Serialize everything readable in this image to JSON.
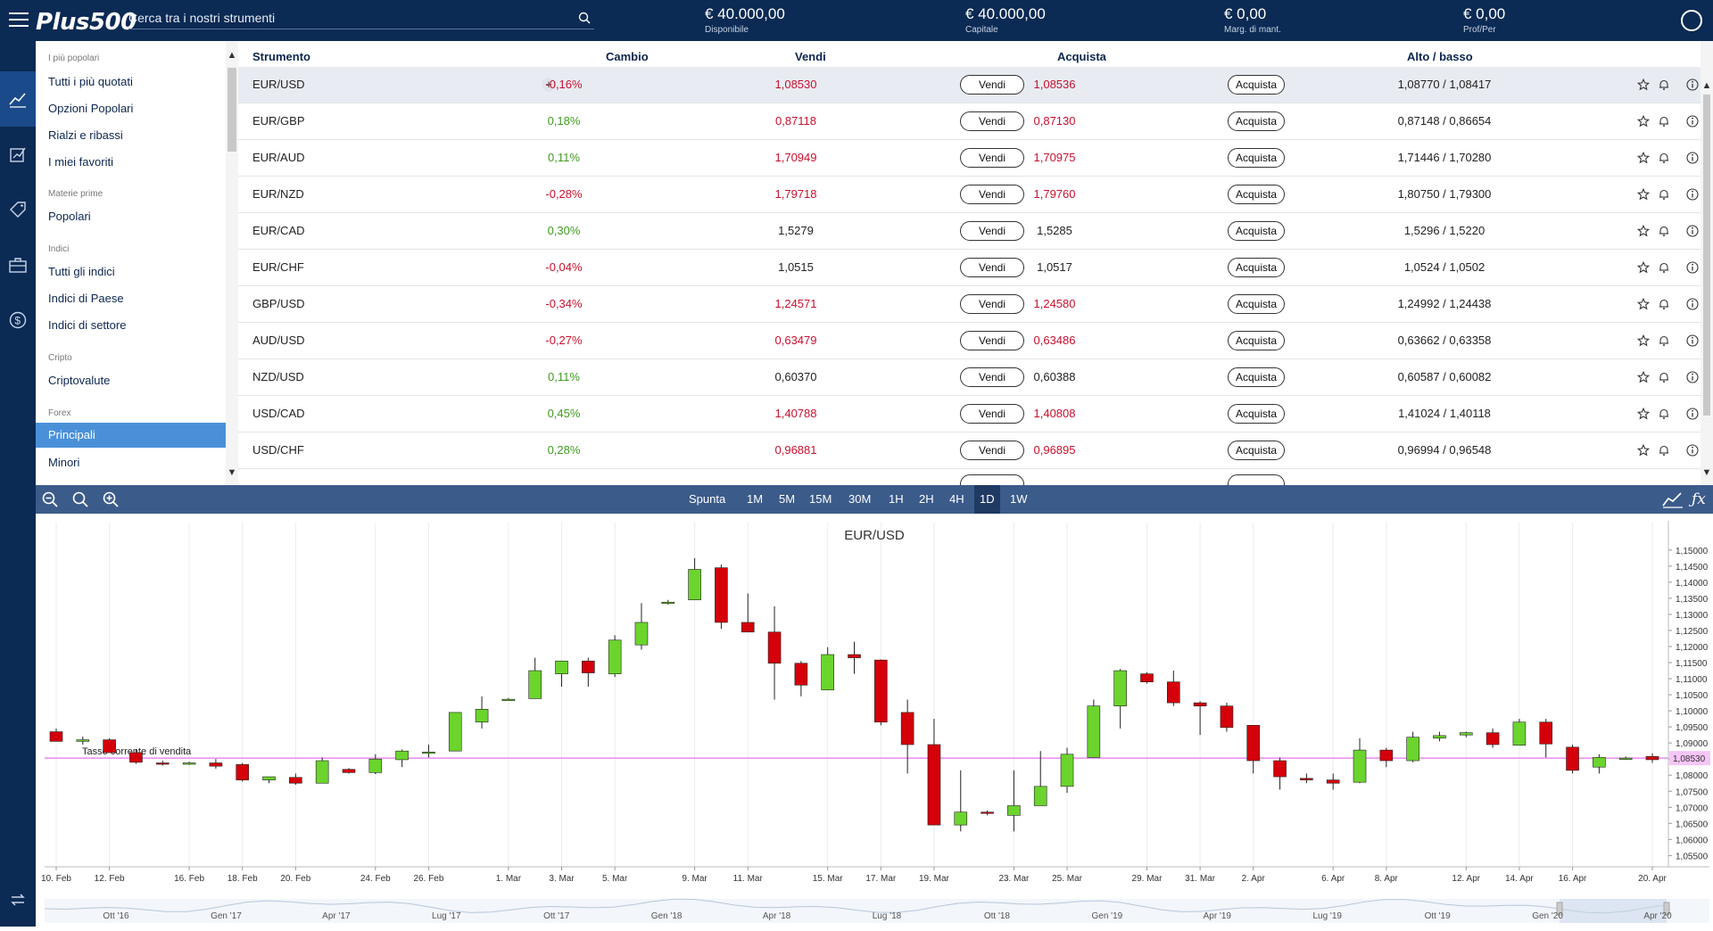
{
  "topbar": {
    "logo": "Plus500",
    "search_placeholder": "Cerca tra i nostri strumenti",
    "available": {
      "value": "€ 40.000,00",
      "label": "Disponibile"
    },
    "capital": {
      "value": "€ 40.000,00",
      "label": "Capitale"
    },
    "margin": {
      "value": "€ 0,00",
      "label": "Marg. di mant."
    },
    "profit": {
      "value": "€ 0,00",
      "label": "Prof/Per"
    }
  },
  "sidebar": {
    "groups": [
      {
        "title": "I più popolari",
        "items": [
          "Tutti i più quotati",
          "Opzioni Popolari",
          "Rialzi e ribassi",
          "I miei favoriti"
        ]
      },
      {
        "title": "Materie prime",
        "items": [
          "Popolari"
        ]
      },
      {
        "title": "Indici",
        "items": [
          "Tutti gli indici",
          "Indici di Paese",
          "Indici di settore"
        ]
      },
      {
        "title": "Cripto",
        "items": [
          "Criptovalute"
        ]
      },
      {
        "title": "Forex",
        "items": [
          "Principali",
          "Minori"
        ]
      }
    ],
    "active_item": "Principali"
  },
  "table": {
    "headers": {
      "instrument": "Strumento",
      "change": "Cambio",
      "sell": "Vendi",
      "buy": "Acquista",
      "highlow": "Alto / basso"
    },
    "sell_label": "Vendi",
    "buy_label": "Acquista",
    "rows": [
      {
        "name": "EUR/USD",
        "change": "-0,16%",
        "trend": "neg",
        "sell": "1,08530",
        "buy": "1,08536",
        "price_color": "neg",
        "highlow": "1,08770 / 1,08417"
      },
      {
        "name": "EUR/GBP",
        "change": "0,18%",
        "trend": "pos",
        "sell": "0,87118",
        "buy": "0,87130",
        "price_color": "neg",
        "highlow": "0,87148 / 0,86654"
      },
      {
        "name": "EUR/AUD",
        "change": "0,11%",
        "trend": "pos",
        "sell": "1,70949",
        "buy": "1,70975",
        "price_color": "neg",
        "highlow": "1,71446 / 1,70280"
      },
      {
        "name": "EUR/NZD",
        "change": "-0,28%",
        "trend": "neg",
        "sell": "1,79718",
        "buy": "1,79760",
        "price_color": "neg",
        "highlow": "1,80750 / 1,79300"
      },
      {
        "name": "EUR/CAD",
        "change": "0,30%",
        "trend": "pos",
        "sell": "1,5279",
        "buy": "1,5285",
        "price_color": "neu",
        "highlow": "1,5296 / 1,5220"
      },
      {
        "name": "EUR/CHF",
        "change": "-0,04%",
        "trend": "neg",
        "sell": "1,0515",
        "buy": "1,0517",
        "price_color": "neu",
        "highlow": "1,0524 / 1,0502"
      },
      {
        "name": "GBP/USD",
        "change": "-0,34%",
        "trend": "neg",
        "sell": "1,24571",
        "buy": "1,24580",
        "price_color": "neg",
        "highlow": "1,24992 / 1,24438"
      },
      {
        "name": "AUD/USD",
        "change": "-0,27%",
        "trend": "neg",
        "sell": "0,63479",
        "buy": "0,63486",
        "price_color": "neg",
        "highlow": "0,63662 / 0,63358"
      },
      {
        "name": "NZD/USD",
        "change": "0,11%",
        "trend": "pos",
        "sell": "0,60370",
        "buy": "0,60388",
        "price_color": "neu",
        "highlow": "0,60587 / 0,60082"
      },
      {
        "name": "USD/CAD",
        "change": "0,45%",
        "trend": "pos",
        "sell": "1,40788",
        "buy": "1,40808",
        "price_color": "neg",
        "highlow": "1,41024 / 1,40118"
      },
      {
        "name": "USD/CHF",
        "change": "0,28%",
        "trend": "pos",
        "sell": "0,96881",
        "buy": "0,96895",
        "price_color": "neg",
        "highlow": "0,96994 / 0,96548"
      }
    ]
  },
  "chart_toolbar": {
    "timeframes": [
      "Spunta",
      "1M",
      "5M",
      "15M",
      "30M",
      "1H",
      "2H",
      "4H",
      "1D",
      "1W"
    ],
    "active": "1D"
  },
  "chart_data": {
    "type": "candlestick",
    "title": "EUR/USD",
    "ylim": [
      1.0515,
      1.153
    ],
    "y_ticks": [
      1.15,
      1.145,
      1.14,
      1.135,
      1.13,
      1.125,
      1.12,
      1.115,
      1.11,
      1.105,
      1.1,
      1.095,
      1.09,
      1.085,
      1.08,
      1.075,
      1.07,
      1.065,
      1.06,
      1.055
    ],
    "y_tick_labels": [
      "1,15000",
      "1,14500",
      "1,14000",
      "1,13500",
      "1,13000",
      "1,12500",
      "1,12000",
      "1,11500",
      "1,11000",
      "1,10500",
      "1,10000",
      "1,09500",
      "1,09000",
      "1,08500",
      "1,08000",
      "1,07500",
      "1,07000",
      "1,06500",
      "1,06000",
      "1,05500"
    ],
    "x_labels": [
      "10. Feb",
      "12. Feb",
      "16. Feb",
      "18. Feb",
      "20. Feb",
      "24. Feb",
      "26. Feb",
      "1. Mar",
      "3. Mar",
      "5. Mar",
      "9. Mar",
      "11. Mar",
      "15. Mar",
      "17. Mar",
      "19. Mar",
      "23. Mar",
      "25. Mar",
      "29. Mar",
      "31. Mar",
      "2. Apr",
      "6. Apr",
      "8. Apr",
      "12. Apr",
      "14. Apr",
      "16. Apr",
      "20. Apr"
    ],
    "x_label_index": [
      0,
      2,
      5,
      7,
      9,
      12,
      14,
      17,
      19,
      21,
      24,
      26,
      29,
      31,
      33,
      36,
      38,
      41,
      43,
      45,
      48,
      50,
      53,
      55,
      57,
      60
    ],
    "candles": [
      [
        1.0935,
        1.0945,
        1.0905,
        1.0905
      ],
      [
        1.0905,
        1.092,
        1.0895,
        1.091
      ],
      [
        1.091,
        1.0915,
        1.087,
        1.087
      ],
      [
        1.087,
        1.088,
        1.0835,
        1.084
      ],
      [
        1.0838,
        1.0845,
        1.083,
        1.0836
      ],
      [
        1.0838,
        1.0842,
        1.0832,
        1.0838
      ],
      [
        1.0838,
        1.085,
        1.082,
        1.0828
      ],
      [
        1.0833,
        1.0838,
        1.078,
        1.0785
      ],
      [
        1.0785,
        1.0795,
        1.0775,
        1.0795
      ],
      [
        1.0793,
        1.0805,
        1.077,
        1.0775
      ],
      [
        1.0775,
        1.0855,
        1.0775,
        1.0845
      ],
      [
        1.0818,
        1.0822,
        1.0805,
        1.0808
      ],
      [
        1.0808,
        1.0865,
        1.0803,
        1.085
      ],
      [
        1.0848,
        1.088,
        1.0825,
        1.0875
      ],
      [
        1.0872,
        1.0895,
        1.0855,
        1.0872
      ],
      [
        1.0875,
        1.0995,
        1.0875,
        1.0995
      ],
      [
        1.0965,
        1.1045,
        1.0945,
        1.1005
      ],
      [
        1.1035,
        1.104,
        1.1032,
        1.1036
      ],
      [
        1.1038,
        1.1165,
        1.1038,
        1.1125
      ],
      [
        1.1115,
        1.1145,
        1.1075,
        1.1155
      ],
      [
        1.1155,
        1.1165,
        1.1075,
        1.1118
      ],
      [
        1.1115,
        1.1235,
        1.1105,
        1.122
      ],
      [
        1.1205,
        1.1335,
        1.119,
        1.1275
      ],
      [
        1.1335,
        1.1345,
        1.133,
        1.1338
      ],
      [
        1.1345,
        1.1475,
        1.1345,
        1.144
      ],
      [
        1.1445,
        1.1455,
        1.1255,
        1.1275
      ],
      [
        1.1275,
        1.1365,
        1.1245,
        1.1245
      ],
      [
        1.1245,
        1.1325,
        1.1035,
        1.1148
      ],
      [
        1.1148,
        1.1155,
        1.1045,
        1.108
      ],
      [
        1.1065,
        1.1198,
        1.1065,
        1.1175
      ],
      [
        1.1175,
        1.1215,
        1.1115,
        1.1165
      ],
      [
        1.1158,
        1.116,
        1.0955,
        1.0965
      ],
      [
        1.0995,
        1.1035,
        1.0805,
        1.0895
      ],
      [
        1.0895,
        1.0975,
        1.0645,
        1.0645
      ],
      [
        1.0645,
        1.0815,
        1.0625,
        1.0685
      ],
      [
        1.0685,
        1.069,
        1.0675,
        1.0683
      ],
      [
        1.0675,
        1.0815,
        1.0625,
        1.0705
      ],
      [
        1.0705,
        1.0875,
        1.0705,
        1.0765
      ],
      [
        1.0765,
        1.0885,
        1.0745,
        1.0865
      ],
      [
        1.0855,
        1.1035,
        1.0855,
        1.1015
      ],
      [
        1.1015,
        1.113,
        1.0945,
        1.1125
      ],
      [
        1.1115,
        1.112,
        1.1085,
        1.109
      ],
      [
        1.109,
        1.1125,
        1.1015,
        1.1025
      ],
      [
        1.1025,
        1.103,
        1.0925,
        1.1015
      ],
      [
        1.1015,
        1.1025,
        1.0935,
        1.0948
      ],
      [
        1.0955,
        1.0955,
        1.0805,
        1.0845
      ],
      [
        1.0845,
        1.0855,
        1.0755,
        1.0795
      ],
      [
        1.079,
        1.0805,
        1.0775,
        1.0785
      ],
      [
        1.0785,
        1.0805,
        1.0755,
        1.0775
      ],
      [
        1.0778,
        1.0915,
        1.0775,
        1.0878
      ],
      [
        1.0878,
        1.0885,
        1.0825,
        1.0845
      ],
      [
        1.0845,
        1.0935,
        1.084,
        1.0918
      ],
      [
        1.0915,
        1.0935,
        1.0905,
        1.0923
      ],
      [
        1.0925,
        1.0935,
        1.0918,
        1.0932
      ],
      [
        1.0932,
        1.0945,
        1.0885,
        1.0895
      ],
      [
        1.0893,
        1.0975,
        1.0893,
        1.0965
      ],
      [
        1.0965,
        1.0975,
        1.0855,
        1.0897
      ],
      [
        1.0887,
        1.0895,
        1.0805,
        1.0815
      ],
      [
        1.0825,
        1.0865,
        1.0805,
        1.0855
      ],
      [
        1.0853,
        1.0858,
        1.0848,
        1.0853
      ],
      [
        1.0858,
        1.0868,
        1.0838,
        1.0848
      ]
    ],
    "current_rate": 1.0853,
    "current_rate_label": "1,08530",
    "rate_line_label": "Tasso corrente di vendita",
    "navigator_labels": [
      "Ott '16",
      "Gen '17",
      "Apr '17",
      "Lug '17",
      "Ott '17",
      "Gen '18",
      "Apr '18",
      "Lug '18",
      "Ott '18",
      "Gen '19",
      "Apr '19",
      "Lug '19",
      "Ott '19",
      "Gen '20",
      "Apr '20"
    ],
    "up_color": "#6bd42d",
    "down_color": "#d4000a",
    "rate_line_color": "#e88cf0"
  }
}
